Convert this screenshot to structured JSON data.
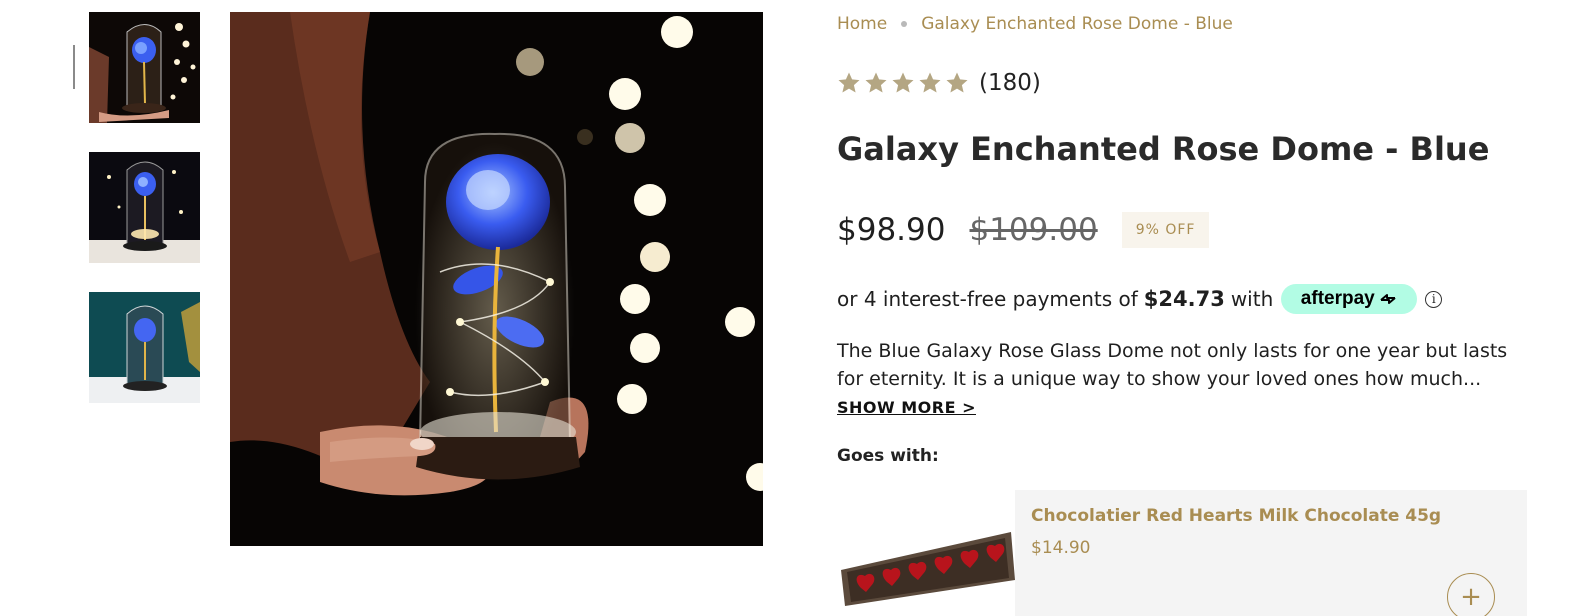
{
  "breadcrumb": {
    "home": "Home",
    "current": "Galaxy Enchanted Rose Dome - Blue"
  },
  "rating": {
    "stars": 5,
    "count": "(180)",
    "star_color": "#b4a683"
  },
  "product": {
    "title": "Galaxy Enchanted Rose Dome - Blue",
    "price": "$98.90",
    "compare_price": "$109.00",
    "discount_badge": "9% OFF"
  },
  "afterpay": {
    "prefix": "or 4 interest-free payments of",
    "amount": "$24.73",
    "with": "with",
    "brand": "afterpay",
    "info_icon": "ⓘ",
    "badge_color": "#b2fce4"
  },
  "description": {
    "text": "The Blue Galaxy Rose Glass Dome not only lasts for one year but lasts for eternity. It is a unique way to show your loved ones how much...",
    "show_more": "SHOW MORE >"
  },
  "goes_with": {
    "heading": "Goes with:",
    "item": {
      "name": "Chocolatier Red Hearts Milk Chocolate 45g",
      "price": "$14.90",
      "add_icon": "+"
    }
  },
  "colors": {
    "accent": "#a98d52",
    "text": "#1f1f1f"
  },
  "icons": [
    "star-icon",
    "afterpay-arrow-icon",
    "info-icon",
    "plus-icon"
  ]
}
